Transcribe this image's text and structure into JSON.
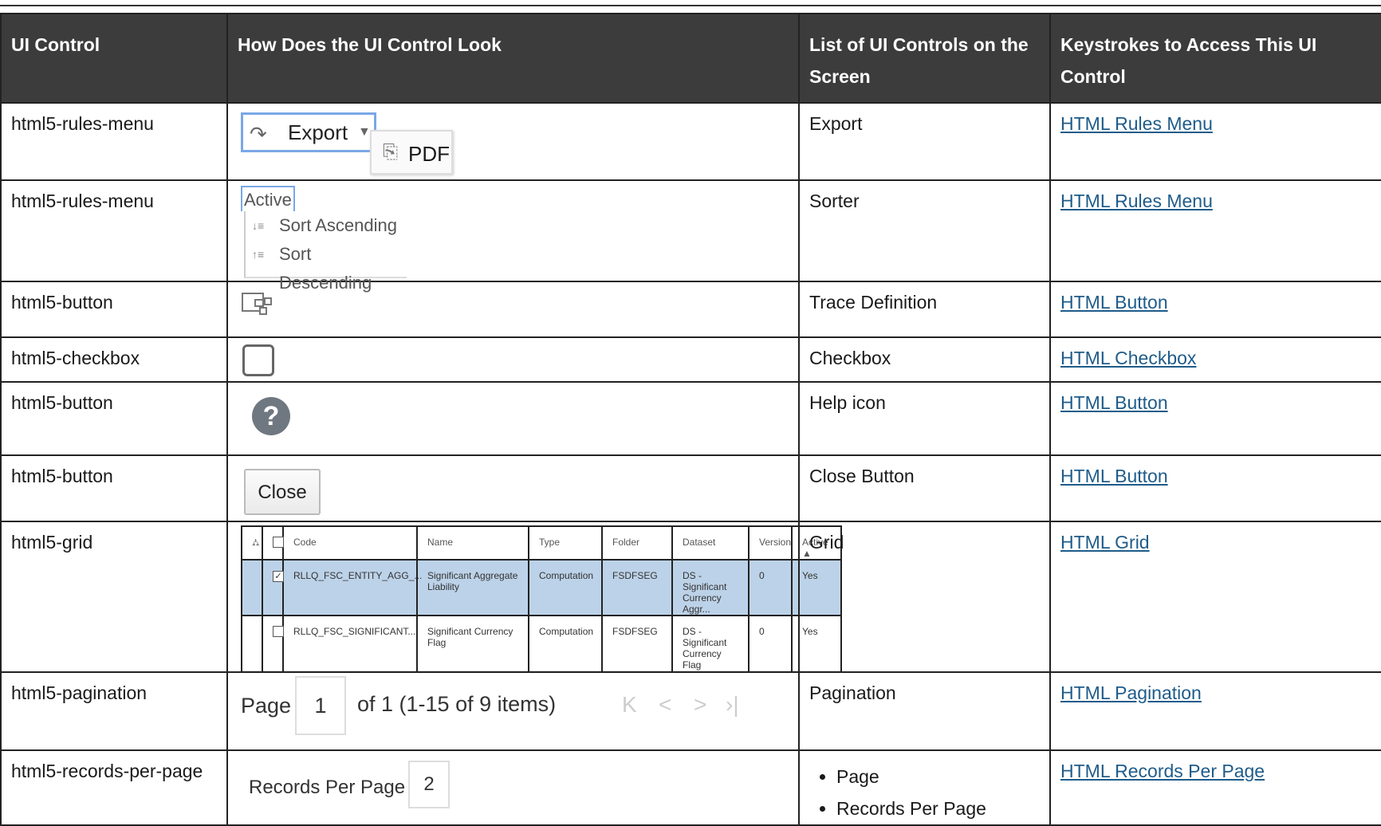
{
  "headers": {
    "ui_control": "UI Control",
    "look": "How Does the UI Control Look",
    "list": "List of UI Controls on the Screen",
    "keys": "Keystrokes to Access This UI Control"
  },
  "rows": [
    {
      "control": "html5-rules-menu",
      "list_label": "Export",
      "link": "HTML Rules Menu"
    },
    {
      "control": "html5-rules-menu",
      "list_label": "Sorter",
      "link": "HTML Rules Menu"
    },
    {
      "control": "html5-button",
      "list_label": "Trace Definition",
      "link": "HTML Button"
    },
    {
      "control": "html5-checkbox",
      "list_label": "Checkbox",
      "link": "HTML Checkbox"
    },
    {
      "control": "html5-button",
      "list_label": "Help icon",
      "link": "HTML Button"
    },
    {
      "control": "html5-button",
      "list_label": "Close Button",
      "link": "HTML Button"
    },
    {
      "control": "html5-grid",
      "list_label": "Grid",
      "link": "HTML Grid"
    },
    {
      "control": "html5-pagination",
      "list_label": "Pagination",
      "link": "HTML Pagination"
    },
    {
      "control": "html5-records-per-page",
      "list_items": [
        "Page",
        "Records Per Page"
      ],
      "link": "HTML Records Per Page"
    }
  ],
  "export_menu": {
    "button": "Export",
    "option": "PDF",
    "icon": "refresh-icon",
    "option_icon": "pdf-icon"
  },
  "sorter": {
    "field": "Active",
    "asc": "Sort Ascending",
    "desc": "Sort Descending"
  },
  "help_glyph": "?",
  "close_label": "Close",
  "grid": {
    "columns": [
      "Code",
      "Name",
      "Type",
      "Folder",
      "Dataset",
      "Version",
      "Active"
    ],
    "sort_indicator": "▲",
    "rows": [
      {
        "checked": true,
        "code": "RLLQ_FSC_ENTITY_AGG_...",
        "name": "Significant Aggregate Liability",
        "type": "Computation",
        "folder": "FSDFSEG",
        "dataset": "DS - Significant Currency Aggr...",
        "version": "0",
        "active": "Yes"
      },
      {
        "checked": false,
        "code": "RLLQ_FSC_SIGNIFICANT...",
        "name": "Significant Currency Flag",
        "type": "Computation",
        "folder": "FSDFSEG",
        "dataset": "DS - Significant Currency Flag",
        "version": "0",
        "active": "Yes"
      }
    ]
  },
  "pagination": {
    "label": "Page",
    "current": "1",
    "of_text": "of 1  (1-15 of  9 items)",
    "first": "K",
    "prev": "<",
    "next": ">",
    "last": "›|"
  },
  "records_per_page": {
    "label": "Records Per Page",
    "value": "2"
  }
}
